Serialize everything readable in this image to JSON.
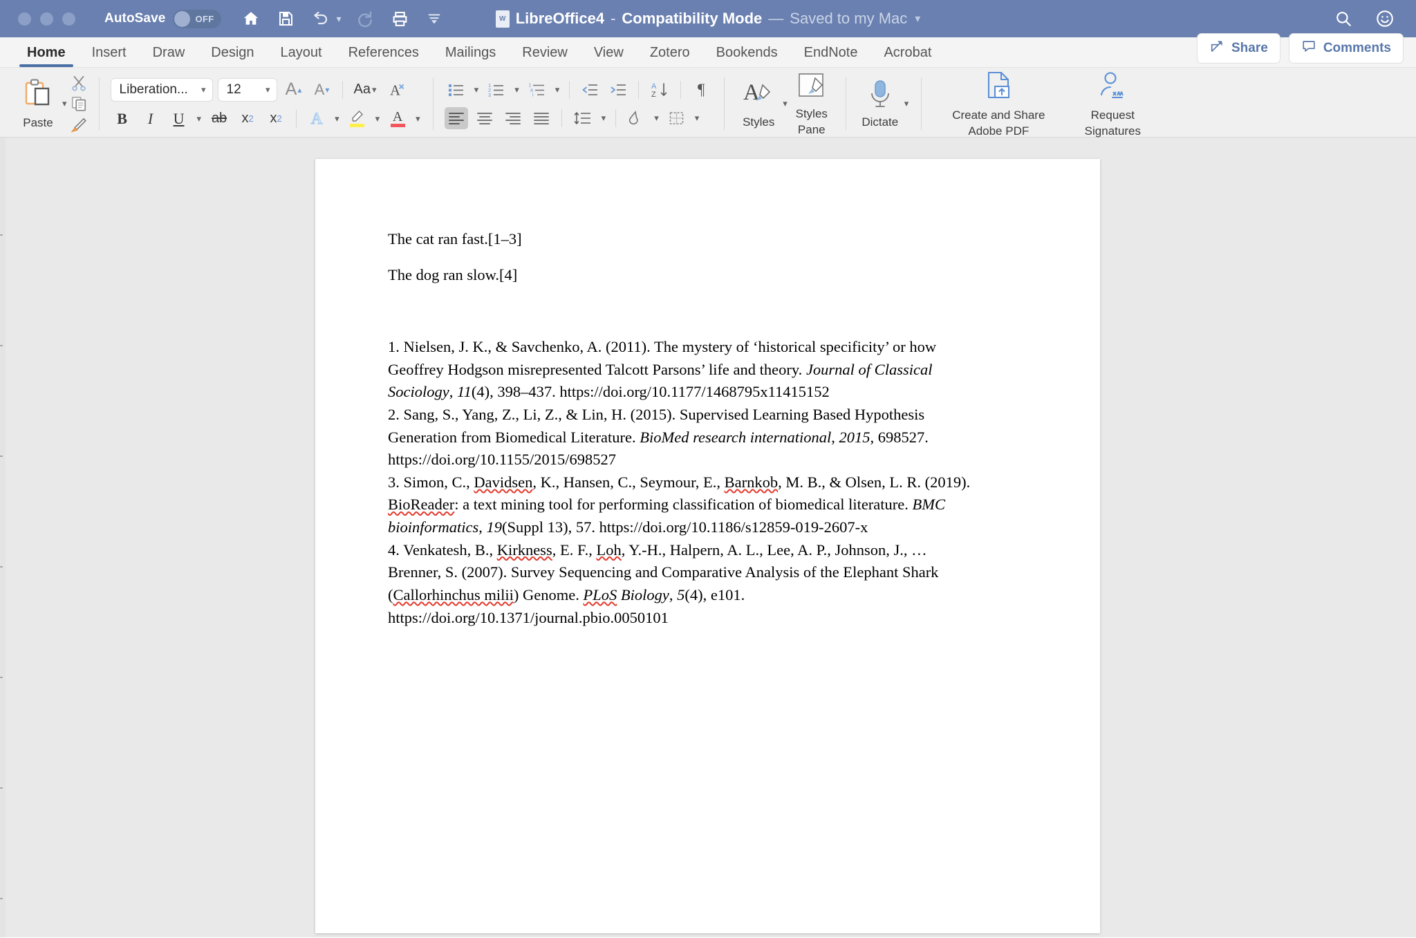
{
  "titlebar": {
    "autosave_label": "AutoSave",
    "autosave_state": "OFF",
    "doc_name": "LibreOffice4",
    "dash": "-",
    "compat": "Compatibility Mode",
    "emdash": "—",
    "saved_status": "Saved to my Mac",
    "quick_access": [
      "home-icon",
      "save-icon",
      "undo-icon",
      "redo-icon",
      "print-icon",
      "customize-icon"
    ],
    "right_icons": [
      "search-icon",
      "feedback-smiley-icon"
    ]
  },
  "tabs": [
    {
      "label": "Home",
      "active": true
    },
    {
      "label": "Insert",
      "active": false
    },
    {
      "label": "Draw",
      "active": false
    },
    {
      "label": "Design",
      "active": false
    },
    {
      "label": "Layout",
      "active": false
    },
    {
      "label": "References",
      "active": false
    },
    {
      "label": "Mailings",
      "active": false
    },
    {
      "label": "Review",
      "active": false
    },
    {
      "label": "View",
      "active": false
    },
    {
      "label": "Zotero",
      "active": false
    },
    {
      "label": "Bookends",
      "active": false
    },
    {
      "label": "EndNote",
      "active": false
    },
    {
      "label": "Acrobat",
      "active": false
    }
  ],
  "tabbar_right": {
    "share_label": "Share",
    "comments_label": "Comments"
  },
  "ribbon": {
    "paste_label": "Paste",
    "font_name": "Liberation...",
    "font_size": "12",
    "grow_font": "A",
    "shrink_font": "A",
    "change_case": "Aa",
    "clear_formatting": "A",
    "bold": "B",
    "italic": "I",
    "underline": "U",
    "strikethrough": "ab",
    "subscript": "x",
    "subscript_sub": "2",
    "superscript": "x",
    "superscript_sup": "2",
    "text_effects": "A",
    "highlight": "A",
    "font_color": "A",
    "styles_label": "Styles",
    "styles_pane_label": "Styles\nPane",
    "styles_pane_line1": "Styles",
    "styles_pane_line2": "Pane",
    "dictate_label": "Dictate",
    "adobe_line1": "Create and Share",
    "adobe_line2": "Adobe PDF",
    "signatures_line1": "Request",
    "signatures_line2": "Signatures",
    "highlight_color": "#ffef4a",
    "font_color_swatch": "#f2565c",
    "accent_blue": "#4a6fa5"
  },
  "document": {
    "paragraphs": [
      "The cat ran fast.[1–3]",
      "The dog ran slow.[4]"
    ],
    "bibliography": [
      {
        "id": 1,
        "parts": [
          {
            "t": "1. Nielsen, J. K., & Savchenko, A. (2011). The mystery of ‘historical specificity’ or how Geoffrey Hodgson misrepresented Talcott Parsons’ life and theory. ",
            "style": "normal"
          },
          {
            "t": "Journal of Classical Sociology",
            "style": "italic"
          },
          {
            "t": ", ",
            "style": "normal"
          },
          {
            "t": "11",
            "style": "italic"
          },
          {
            "t": "(4), 398–437. https://doi.org/10.1177/1468795x11415152",
            "style": "normal"
          }
        ]
      },
      {
        "id": 2,
        "parts": [
          {
            "t": "2. Sang, S., Yang, Z., Li, Z., & Lin, H. (2015). Supervised Learning Based Hypothesis Generation from Biomedical Literature. ",
            "style": "normal"
          },
          {
            "t": "BioMed research international",
            "style": "italic"
          },
          {
            "t": ", ",
            "style": "normal"
          },
          {
            "t": "2015",
            "style": "italic"
          },
          {
            "t": ", 698527. https://doi.org/10.1155/2015/698527",
            "style": "normal"
          }
        ]
      },
      {
        "id": 3,
        "parts": [
          {
            "t": "3. Simon, C., ",
            "style": "normal"
          },
          {
            "t": "Davidsen",
            "style": "spell"
          },
          {
            "t": ", K., Hansen, C., Seymour, E., ",
            "style": "normal"
          },
          {
            "t": "Barnkob",
            "style": "spell"
          },
          {
            "t": ", M. B., & Olsen, L. R. (2019). ",
            "style": "normal"
          },
          {
            "t": "BioReader",
            "style": "spell"
          },
          {
            "t": ": a text mining tool for performing classification of biomedical literature. ",
            "style": "normal"
          },
          {
            "t": "BMC bioinformatics",
            "style": "italic"
          },
          {
            "t": ", ",
            "style": "normal"
          },
          {
            "t": "19",
            "style": "italic"
          },
          {
            "t": "(Suppl 13), 57. https://doi.org/10.1186/s12859-019-2607-x",
            "style": "normal"
          }
        ]
      },
      {
        "id": 4,
        "parts": [
          {
            "t": "4. Venkatesh, B., ",
            "style": "normal"
          },
          {
            "t": "Kirkness",
            "style": "spell"
          },
          {
            "t": ", E. F., ",
            "style": "normal"
          },
          {
            "t": "Loh",
            "style": "spell"
          },
          {
            "t": ", Y.-H., Halpern, A. L., Lee, A. P., Johnson, J., … Brenner, S. (2007). Survey Sequencing and Comparative Analysis of the Elephant Shark (",
            "style": "normal"
          },
          {
            "t": "Callorhinchus milii",
            "style": "spell"
          },
          {
            "t": ") Genome. ",
            "style": "normal"
          },
          {
            "t": "PLoS",
            "style": "italic-spell"
          },
          {
            "t": " Biology",
            "style": "italic"
          },
          {
            "t": ", ",
            "style": "normal"
          },
          {
            "t": "5",
            "style": "italic"
          },
          {
            "t": "(4), e101. https://doi.org/10.1371/journal.pbio.0050101",
            "style": "normal"
          }
        ]
      }
    ]
  }
}
